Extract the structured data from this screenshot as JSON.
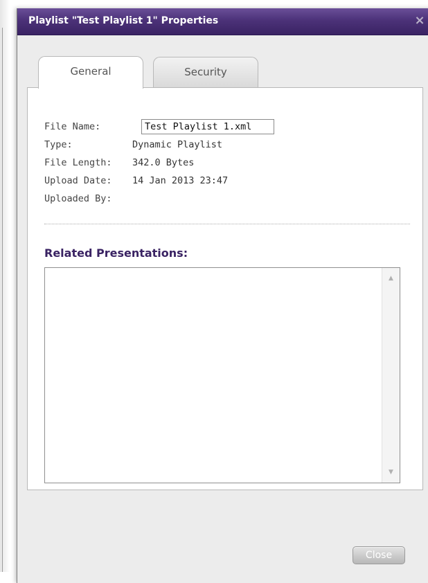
{
  "dialog": {
    "title": "Playlist \"Test Playlist 1\" Properties",
    "close_icon": "×",
    "title_color": "#4c3279"
  },
  "tabs": [
    {
      "label": "General",
      "active": true
    },
    {
      "label": "Security",
      "active": false
    }
  ],
  "properties": {
    "file_name_label": "File Name:",
    "file_name_value": "Test Playlist 1.xml",
    "type_label": "Type:",
    "type_value": "Dynamic Playlist",
    "file_length_label": "File Length:",
    "file_length_value": "342.0 Bytes",
    "upload_date_label": "Upload Date:",
    "upload_date_value": "14 Jan 2013 23:47",
    "uploaded_by_label": "Uploaded By:",
    "uploaded_by_value": ""
  },
  "related": {
    "heading": "Related Presentations:",
    "items": [],
    "scroll_up_icon": "▲",
    "scroll_down_icon": "▼"
  },
  "footer": {
    "close_label": "Close"
  }
}
